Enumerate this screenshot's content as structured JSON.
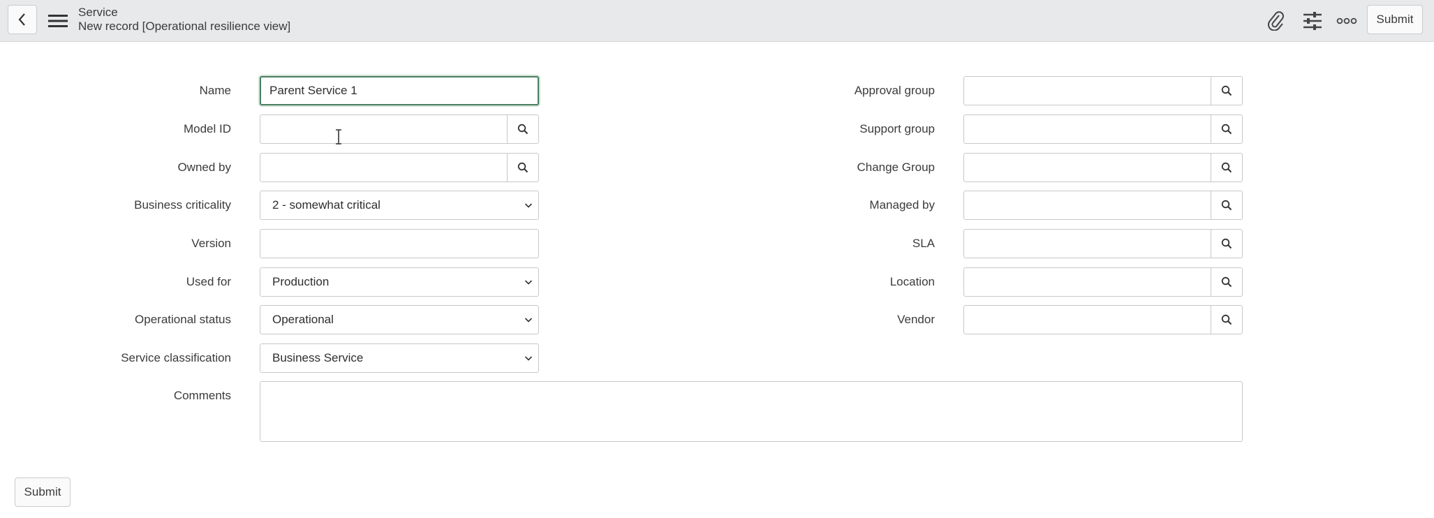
{
  "header": {
    "title": "Service",
    "subtitle": "New record [Operational resilience view]",
    "submit_label": "Submit",
    "icons": [
      "chevron-left-icon",
      "hamburger-menu-icon",
      "paperclip-icon",
      "sliders-icon",
      "more-icon"
    ]
  },
  "form": {
    "left": [
      {
        "label": "Name",
        "value": "Parent Service 1",
        "type": "text",
        "focused": true
      },
      {
        "label": "Model ID",
        "value": "",
        "type": "lookup"
      },
      {
        "label": "Owned by",
        "value": "",
        "type": "lookup"
      },
      {
        "label": "Business criticality",
        "value": "2 - somewhat critical",
        "type": "select"
      },
      {
        "label": "Version",
        "value": "",
        "type": "text"
      },
      {
        "label": "Used for",
        "value": "Production",
        "type": "select"
      },
      {
        "label": "Operational status",
        "value": "Operational",
        "type": "select"
      },
      {
        "label": "Service classification",
        "value": "Business Service",
        "type": "select"
      }
    ],
    "right": [
      {
        "label": "Approval group",
        "value": "",
        "type": "lookup"
      },
      {
        "label": "Support group",
        "value": "",
        "type": "lookup"
      },
      {
        "label": "Change Group",
        "value": "",
        "type": "lookup"
      },
      {
        "label": "Managed by",
        "value": "",
        "type": "lookup"
      },
      {
        "label": "SLA",
        "value": "",
        "type": "lookup"
      },
      {
        "label": "Location",
        "value": "",
        "type": "lookup"
      },
      {
        "label": "Vendor",
        "value": "",
        "type": "lookup"
      }
    ],
    "comments_label": "Comments",
    "comments_value": ""
  },
  "footer": {
    "submit_label": "Submit"
  },
  "colors": {
    "header_bg": "#e8e9ea",
    "focus_border": "#4b7f62",
    "field_border": "#c6c8ca"
  }
}
